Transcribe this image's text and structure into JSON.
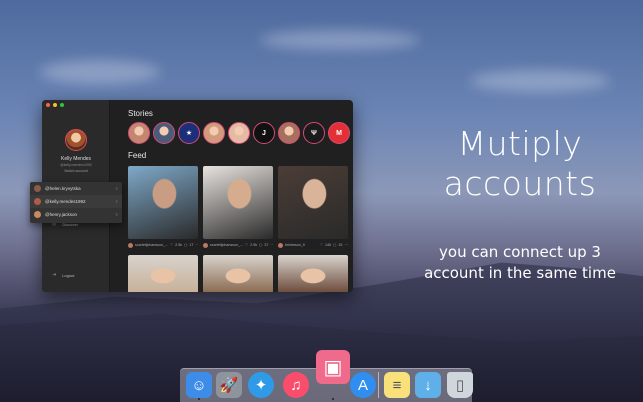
{
  "headline": {
    "line1": "Mutiply",
    "line2": "accounts"
  },
  "subheadline": {
    "line1": "you can connect up 3",
    "line2": "account in the same time"
  },
  "app": {
    "profile": {
      "name": "Kelly Mendes",
      "handle": "@kelly.mendes1992",
      "switch_label": "Switch account"
    },
    "account_switcher": [
      {
        "handle": "@helen.kryvytska",
        "avatar_color": "#8a5b4b"
      },
      {
        "handle": "@kelly.mendes1992",
        "avatar_color": "#b05a4a"
      },
      {
        "handle": "@henry.jackson",
        "avatar_color": "#c98a62"
      }
    ],
    "menu": {
      "discover_label": "Discover",
      "logout_label": "Logout"
    },
    "stories_title": "Stories",
    "feed_title": "Feed",
    "stories": [
      {
        "icon": "person-avatar",
        "color": "#c4866e"
      },
      {
        "icon": "person-avatar",
        "color": "#4b5c7a"
      },
      {
        "icon": "champions-league-logo",
        "color": "#1e2f7a"
      },
      {
        "icon": "person-avatar",
        "color": "#d49a7c"
      },
      {
        "icon": "person-avatar",
        "color": "#e6b9a4"
      },
      {
        "icon": "juventus-logo",
        "color": "#111111"
      },
      {
        "icon": "person-avatar",
        "color": "#a86f5e"
      },
      {
        "icon": "maserati-logo",
        "color": "#1b1b1b"
      },
      {
        "icon": "marvel-logo",
        "color": "#e23036"
      }
    ],
    "feed": [
      {
        "user": "scarlettjohansson_...",
        "likes": "2.5k",
        "comments": "17",
        "photo": "person-photo",
        "color_a": "#7fa9c9",
        "color_b": "#c99d84"
      },
      {
        "user": "scarlettjohansson_...",
        "likes": "2.9k",
        "comments": "37",
        "photo": "person-photo",
        "color_a": "#e8e3df",
        "color_b": "#d5ad8e"
      },
      {
        "user": "brielarson_fi",
        "likes": "146",
        "comments": "15",
        "photo": "person-photo",
        "color_a": "#4b3d36",
        "color_b": "#d9b39a"
      }
    ],
    "feed_row2": [
      {
        "photo": "person-photo",
        "color": "#c7b099"
      },
      {
        "photo": "person-photo",
        "color": "#8a6a50"
      },
      {
        "photo": "person-photo",
        "color": "#6b4a3a"
      }
    ]
  },
  "dock": [
    {
      "name": "finder-icon",
      "color": "#3d8de8"
    },
    {
      "name": "launchpad-icon",
      "color": "#8d949e"
    },
    {
      "name": "safari-icon",
      "color": "#2f9be8"
    },
    {
      "name": "music-icon",
      "color": "#fa4d6b"
    },
    {
      "name": "grids-app-icon",
      "color": "#f06a8c"
    },
    {
      "name": "app-store-icon",
      "color": "#2f8ef0"
    },
    {
      "name": "notes-icon",
      "color": "#f8e07a"
    },
    {
      "name": "downloads-folder-icon",
      "color": "#5fb0e8"
    },
    {
      "name": "trash-icon",
      "color": "#cfd6dc"
    }
  ]
}
